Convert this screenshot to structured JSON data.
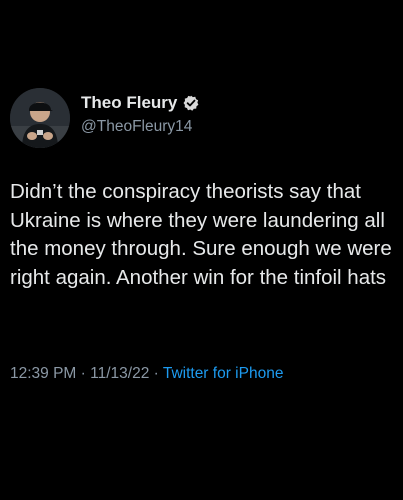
{
  "colors": {
    "background": "#000000",
    "text_primary": "#e7e9ea",
    "text_secondary": "#8b98a5",
    "accent": "#1d9bf0"
  },
  "author": {
    "display_name": "Theo Fleury",
    "handle": "@TheoFleury14",
    "verified_icon": "verified-badge-icon",
    "avatar_icon": "profile-photo-avatar"
  },
  "tweet": {
    "text": "Didn’t the conspiracy theorists say that Ukraine is where they were laundering all the money through. Sure enough we were right again. Another win for the tinfoil hats"
  },
  "meta": {
    "time": "12:39 PM",
    "separator": " · ",
    "date": "11/13/22",
    "source": "Twitter for iPhone"
  }
}
